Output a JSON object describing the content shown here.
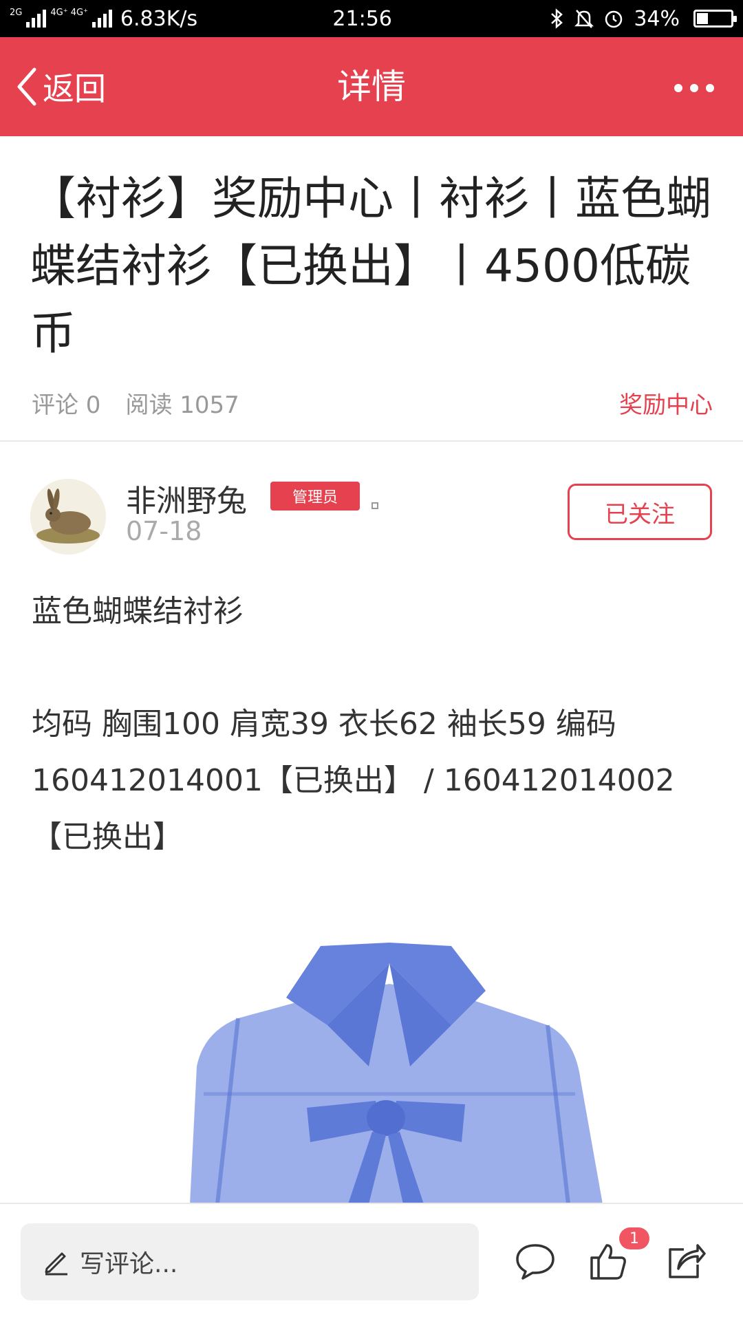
{
  "status_bar": {
    "network_labels": [
      "2G",
      "4G⁺ 4G⁺"
    ],
    "speed": "6.83K/s",
    "time": "21:56",
    "battery": "34%",
    "battery_level": 0.34,
    "icons": [
      "bluetooth-icon",
      "bell-muted-icon",
      "alarm-icon"
    ]
  },
  "nav": {
    "back_label": "返回",
    "title": "详情"
  },
  "article": {
    "title": "【衬衫】奖励中心丨衬衫丨蓝色蝴蝶结衬衫【已换出】丨4500低碳币",
    "comments": "评论 0",
    "reads": "阅读 1057",
    "category": "奖励中心"
  },
  "author": {
    "name": "非洲野兔",
    "badge": "管理员",
    "date": "07-18",
    "follow_label": "已关注"
  },
  "body": {
    "line1": "蓝色蝴蝶结衬衫",
    "line2": "均码 胸围100  肩宽39 衣长62 袖长59  编码160412014001【已换出】 / 160412014002【已换出】"
  },
  "bottom_bar": {
    "comment_placeholder": "写评论...",
    "like_count": "1"
  },
  "colors": {
    "accent": "#e5414f",
    "badge": "#f05561",
    "shirt": "#6a86dc"
  }
}
